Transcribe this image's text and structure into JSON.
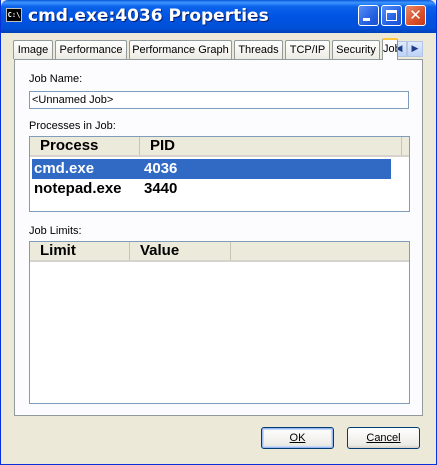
{
  "window": {
    "title": "cmd.exe:4036 Properties",
    "icon": "C:\\"
  },
  "caption_buttons": {
    "minimize": "minimize-icon",
    "maximize": "maximize-icon",
    "close": "✕"
  },
  "tabs": [
    {
      "label": "Image"
    },
    {
      "label": "Performance"
    },
    {
      "label": "Performance Graph"
    },
    {
      "label": "Threads"
    },
    {
      "label": "TCP/IP"
    },
    {
      "label": "Security"
    },
    {
      "label": "Job"
    }
  ],
  "tab_scroll": {
    "left": "◀",
    "right": "▶"
  },
  "job": {
    "name_label": "Job Name:",
    "name_value": "<Unnamed Job>",
    "processes_label": "Processes in Job:",
    "processes_columns": [
      "Process",
      "PID"
    ],
    "processes": [
      {
        "process": "cmd.exe",
        "pid": "4036",
        "selected": true
      },
      {
        "process": "notepad.exe",
        "pid": "3440",
        "selected": false
      }
    ],
    "limits_label": "Job Limits:",
    "limits_columns": [
      "Limit",
      "Value"
    ],
    "limits": []
  },
  "buttons": {
    "ok": "OK",
    "cancel": "Cancel"
  },
  "colors": {
    "titlebar": "#0054e3",
    "selection": "#316ac5",
    "active_tab_accent": "#ffc83c",
    "dialog_bg": "#ece9d8"
  }
}
